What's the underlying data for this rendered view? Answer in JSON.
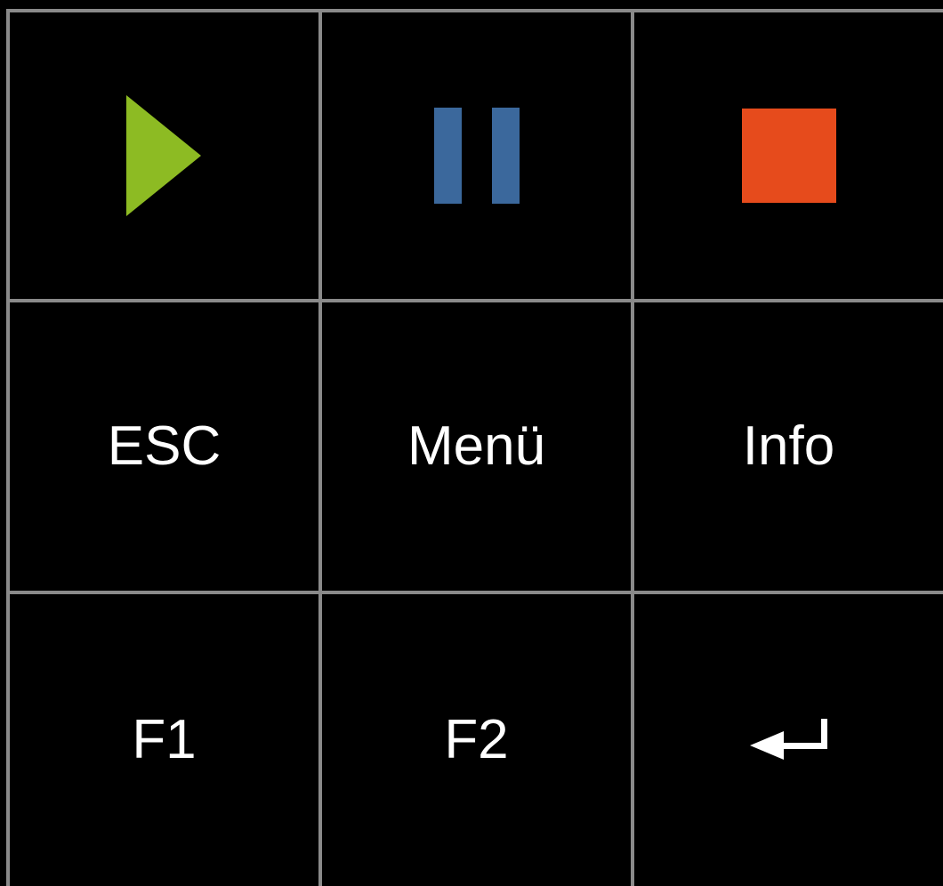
{
  "keypad": {
    "row1": [
      {
        "icon": "play-icon",
        "color": "#8dbb23"
      },
      {
        "icon": "pause-icon",
        "color": "#3b689c"
      },
      {
        "icon": "stop-icon",
        "color": "#e64b1c"
      }
    ],
    "row2": [
      {
        "label": "ESC"
      },
      {
        "label": "Menü"
      },
      {
        "label": "Info"
      }
    ],
    "row3": [
      {
        "label": "F1"
      },
      {
        "label": "F2"
      },
      {
        "icon": "enter-icon",
        "color": "#ffffff"
      }
    ],
    "grid_line_color": "#8a8a8a",
    "background": "#000000"
  }
}
